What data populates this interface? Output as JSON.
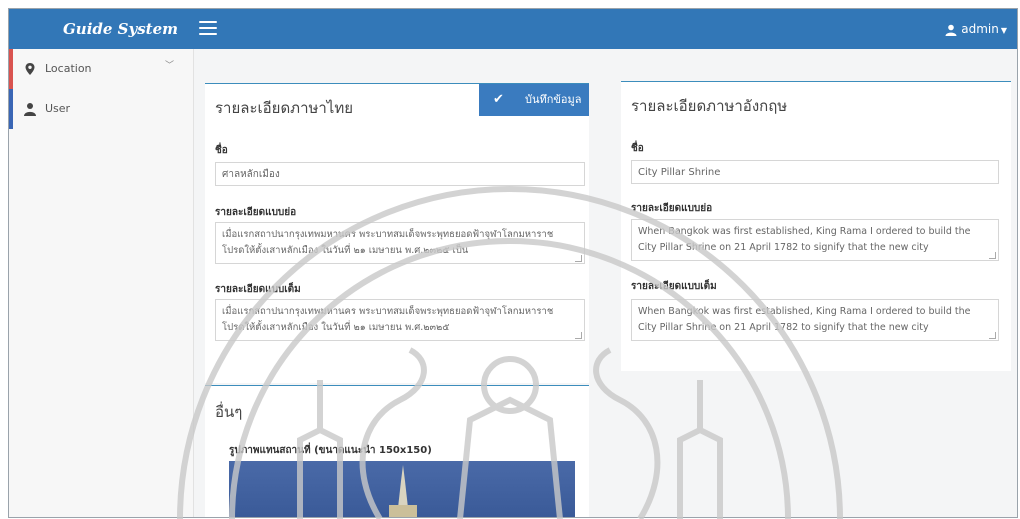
{
  "app": {
    "brand": "Guide System",
    "user": "admin"
  },
  "sidebar": {
    "items": [
      {
        "label": "Location",
        "icon": "map-marker-icon",
        "accent": "#d9534f",
        "has_submenu": true
      },
      {
        "label": "User",
        "icon": "user-icon",
        "accent": "#3a66b5",
        "has_submenu": false
      }
    ]
  },
  "thai_panel": {
    "title": "รายละเอียดภาษาไทย",
    "save_label": "บันทึกข้อมูล",
    "name_label": "ชื่อ",
    "name_value": "ศาลหลักเมือง",
    "short_label": "รายละเอียดแบบย่อ",
    "short_value": "เมื่อแรกสถาปนากรุงเทพมหานคร พระบาทสมเด็จพระพุทธยอดฟ้าจุฬาโลกมหาราช โปรดให้ตั้งเสาหลักเมือง ในวันที่ ๒๑ เมษายน พ.ศ.๒๓๒๕ เป็น",
    "full_label": "รายละเอียดแบบเต็ม",
    "full_value": "เมื่อแรกสถาปนากรุงเทพมหานคร พระบาทสมเด็จพระพุทธยอดฟ้าจุฬาโลกมหาราช โปรดให้ตั้งเสาหลักเมือง ในวันที่ ๒๑ เมษายน พ.ศ.๒๓๒๕"
  },
  "english_panel": {
    "title": "รายละเอียดภาษาอังกฤษ",
    "name_label": "ชื่อ",
    "name_value": "City Pillar Shrine",
    "short_label": "รายละเอียดแบบย่อ",
    "short_value": "When Bangkok was first established, King Rama I ordered to build the City Pillar Shrine on 21 April 1782 to signify that the new city",
    "full_label": "รายละเอียดแบบเต็ม",
    "full_value": "When Bangkok was first established, King Rama I ordered to build the City Pillar Shrine on 21 April 1782 to signify that the new city"
  },
  "other_panel": {
    "title": "อื่นๆ",
    "image_label": "รูปภาพแทนสถานที่ (ขนาดแนะนำ 150x150)"
  },
  "colors": {
    "topbar": "#3277b7",
    "accent_border": "#3c8dbc",
    "save_button": "#3a7bbf",
    "watermark": "#c9c9c9"
  }
}
